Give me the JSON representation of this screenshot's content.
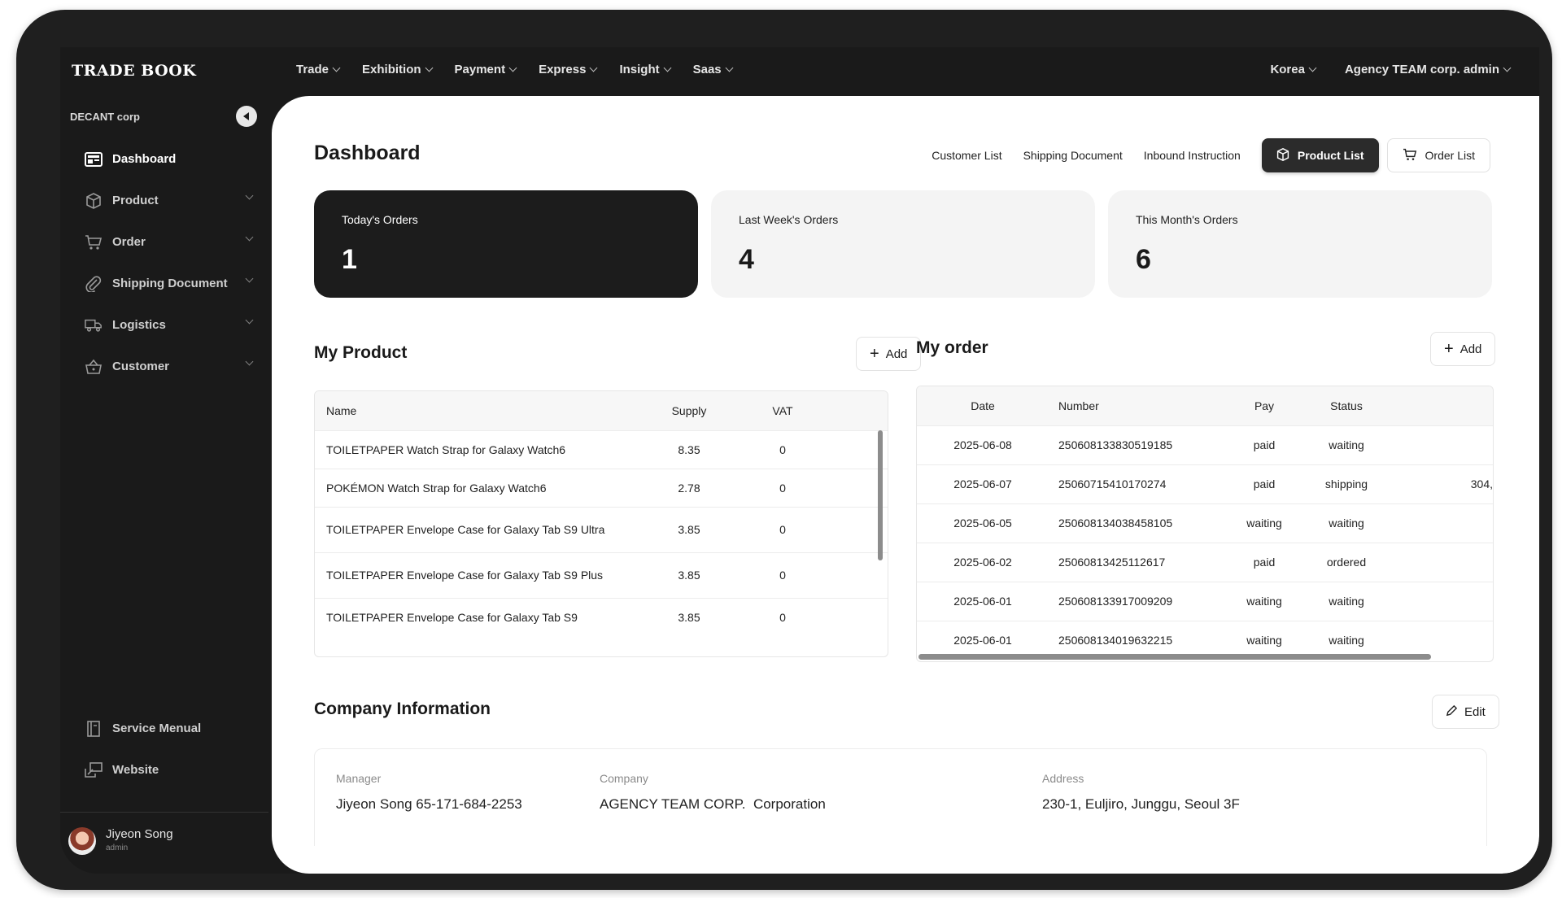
{
  "brand": "TRADE BOOK",
  "nav": {
    "items": [
      "Trade",
      "Exhibition",
      "Payment",
      "Express",
      "Insight",
      "Saas"
    ],
    "region": "Korea",
    "account": "Agency TEAM corp. admin"
  },
  "sidebar": {
    "org": "DECANT corp",
    "items": [
      {
        "label": "Dashboard",
        "icon": "dashboard-icon"
      },
      {
        "label": "Product",
        "icon": "box-icon"
      },
      {
        "label": "Order",
        "icon": "cart-icon"
      },
      {
        "label": "Shipping Document",
        "icon": "paperclip-icon"
      },
      {
        "label": "Logistics",
        "icon": "truck-icon"
      },
      {
        "label": "Customer",
        "icon": "basket-icon"
      }
    ],
    "bottom": [
      {
        "label": "Service Menual",
        "icon": "book-icon"
      },
      {
        "label": "Website",
        "icon": "website-icon"
      }
    ],
    "user": {
      "name": "Jiyeon Song",
      "role": "admin"
    }
  },
  "page": {
    "title": "Dashboard",
    "links": [
      "Customer List",
      "Shipping Document",
      "Inbound Instruction"
    ],
    "product_list_btn": "Product List",
    "order_list_btn": "Order List"
  },
  "stats": [
    {
      "label": "Today's Orders",
      "value": "1"
    },
    {
      "label": "Last Week's Orders",
      "value": "4"
    },
    {
      "label": "This Month's Orders",
      "value": "6"
    }
  ],
  "my_product": {
    "title": "My Product",
    "add_label": "Add",
    "columns": [
      "Name",
      "Supply",
      "VAT"
    ],
    "rows": [
      {
        "name": "TOILETPAPER Watch Strap for Galaxy Watch6",
        "supply": "8.35",
        "vat": "0"
      },
      {
        "name": "POKÉMON Watch Strap for Galaxy Watch6",
        "supply": "2.78",
        "vat": "0"
      },
      {
        "name": "TOILETPAPER Envelope Case for Galaxy Tab S9 Ultra",
        "supply": "3.85",
        "vat": "0"
      },
      {
        "name": "TOILETPAPER Envelope Case for Galaxy Tab S9 Plus",
        "supply": "3.85",
        "vat": "0"
      },
      {
        "name": "TOILETPAPER Envelope Case for Galaxy Tab S9",
        "supply": "3.85",
        "vat": "0"
      }
    ]
  },
  "my_order": {
    "title": "My order",
    "add_label": "Add",
    "columns": [
      "Date",
      "Number",
      "Pay",
      "Status"
    ],
    "rows": [
      {
        "date": "2025-06-08",
        "number": "250608133830519185",
        "pay": "paid",
        "status": "waiting",
        "extra": ""
      },
      {
        "date": "2025-06-07",
        "number": "25060715410170274",
        "pay": "paid",
        "status": "shipping",
        "extra": "304,"
      },
      {
        "date": "2025-06-05",
        "number": "250608134038458105",
        "pay": "waiting",
        "status": "waiting",
        "extra": ""
      },
      {
        "date": "2025-06-02",
        "number": "25060813425112617",
        "pay": "paid",
        "status": "ordered",
        "extra": ""
      },
      {
        "date": "2025-06-01",
        "number": "250608133917009209",
        "pay": "waiting",
        "status": "waiting",
        "extra": ""
      },
      {
        "date": "2025-06-01",
        "number": "250608134019632215",
        "pay": "waiting",
        "status": "waiting",
        "extra": ""
      }
    ]
  },
  "company": {
    "title": "Company Information",
    "edit_label": "Edit",
    "manager_label": "Manager",
    "manager_value": "Jiyeon Song 65-171-684-2253",
    "company_label": "Company",
    "company_value": "AGENCY TEAM CORP.  Corporation",
    "address_label": "Address",
    "address_value": "230-1, Euljiro, Junggu, Seoul 3F"
  }
}
